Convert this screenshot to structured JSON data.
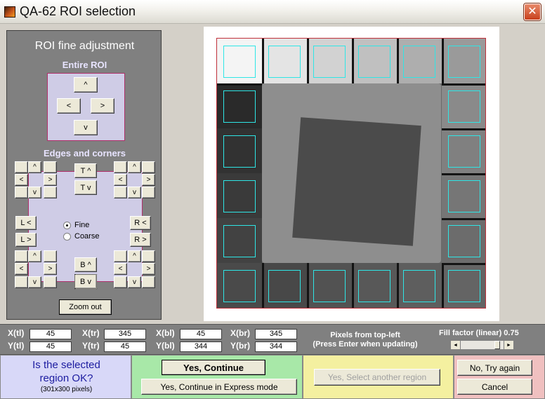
{
  "window": {
    "title": "QA-62 ROI selection",
    "close_glyph": "✕",
    "icon": "matlab-icon"
  },
  "left_panel": {
    "title": "ROI fine adjustment",
    "entire_roi_label": "Entire ROI",
    "edges_label": "Edges and corners",
    "arrows": {
      "up": "^",
      "down": "v",
      "left": "<",
      "right": ">"
    },
    "edge_buttons": {
      "top_up": "T ^",
      "top_down": "T v",
      "bottom_up": "B ^",
      "bottom_down": "B v",
      "left_left": "L <",
      "left_right": "L >",
      "right_left": "R <",
      "right_right": "R >"
    },
    "radio": {
      "fine": "Fine",
      "coarse": "Coarse",
      "selected": "Fine"
    },
    "zoom_label": "Zoom out"
  },
  "coords": {
    "x_tl_label": "X(tl)",
    "x_tl": "45",
    "y_tl_label": "Y(tl)",
    "y_tl": "45",
    "x_tr_label": "X(tr)",
    "x_tr": "345",
    "y_tr_label": "Y(tr)",
    "y_tr": "45",
    "x_bl_label": "X(bl)",
    "x_bl": "45",
    "y_bl_label": "Y(bl)",
    "y_bl": "344",
    "x_br_label": "X(br)",
    "x_br": "345",
    "y_br_label": "Y(br)",
    "y_br": "344",
    "hint_line1": "Pixels from top-left",
    "hint_line2": "(Press Enter when updating)",
    "fill_factor_label": "Fill factor (linear)  0.75",
    "fill_factor": 0.75
  },
  "question": {
    "line1": "Is the selected",
    "line2": "region OK?",
    "size": "(301x300 pixels)"
  },
  "actions": {
    "yes_continue": "Yes, Continue",
    "yes_express": "Yes, Continue in Express mode",
    "yes_another": "Yes, Select another region",
    "no_try_again": "No, Try again",
    "cancel": "Cancel"
  },
  "colors": {
    "roi_outline": "#2ee6e6",
    "frame_outline": "#c0303a",
    "question_text": "#1c1ca0"
  }
}
